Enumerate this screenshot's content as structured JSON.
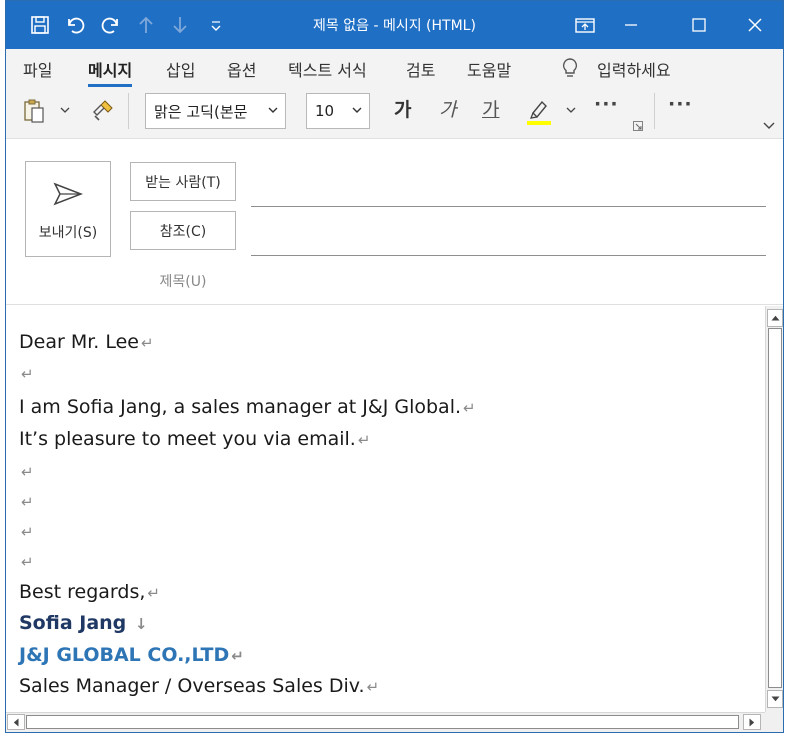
{
  "window": {
    "title": "제목 없음  -  메시지 (HTML)"
  },
  "ribbon": {
    "tabs": [
      {
        "label": "파일"
      },
      {
        "label": "메시지"
      },
      {
        "label": "삽입"
      },
      {
        "label": "옵션"
      },
      {
        "label": "텍스트 서식"
      },
      {
        "label": "검토"
      },
      {
        "label": "도움말"
      }
    ],
    "tell_me": "입력하세요",
    "font_name": "맑은 고딕(본문",
    "font_size": "10",
    "format_bold": "가",
    "format_italic": "가",
    "format_underline": "가",
    "more": "···",
    "highlight_color": "#ffff00"
  },
  "header": {
    "send_label": "보내기(S)",
    "to_label": "받는 사람(T)",
    "cc_label": "참조(C)",
    "subject_label": "제목(U)"
  },
  "body": {
    "lines": [
      {
        "text": "Dear Mr. Lee",
        "mark": "↵"
      },
      {
        "text": "",
        "mark": "↵"
      },
      {
        "text": "I am Sofia Jang, a sales manager at J&J Global.",
        "mark": "↵"
      },
      {
        "text": "It’s pleasure to meet you via email.",
        "mark": "↵"
      },
      {
        "text": "",
        "mark": "↵"
      },
      {
        "text": "",
        "mark": "↵"
      },
      {
        "text": "",
        "mark": "↵"
      },
      {
        "text": "",
        "mark": "↵"
      },
      {
        "text": "Best regards,",
        "mark": "↵"
      },
      {
        "text": "Sofia Jang",
        "mark": "↓"
      },
      {
        "text": "J&J GLOBAL CO.,LTD",
        "mark": "↵"
      },
      {
        "text": "Sales Manager / Overseas Sales Div.",
        "mark": "↵"
      }
    ]
  },
  "colors": {
    "titlebar": "#1f6fc5",
    "signature_name": "#1f3864",
    "signature_company": "#2e75b6"
  }
}
